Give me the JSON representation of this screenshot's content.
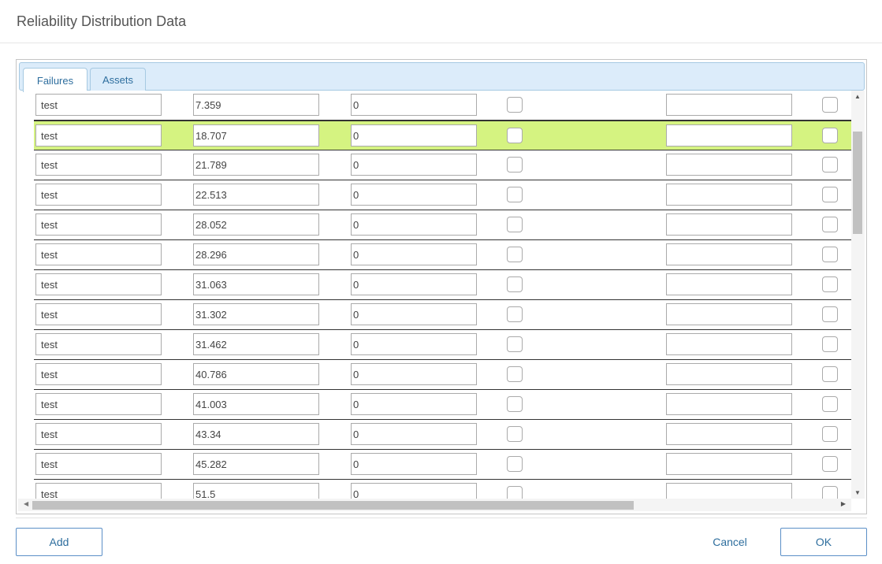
{
  "dialog": {
    "title": "Reliability Distribution Data"
  },
  "tabs": [
    {
      "label": "Failures",
      "active": true
    },
    {
      "label": "Assets",
      "active": false
    }
  ],
  "rows": [
    {
      "name": "test",
      "time": "7.359",
      "qty": "0",
      "note": "",
      "selected": false
    },
    {
      "name": "test",
      "time": "18.707",
      "qty": "0",
      "note": "",
      "selected": true
    },
    {
      "name": "test",
      "time": "21.789",
      "qty": "0",
      "note": "",
      "selected": false
    },
    {
      "name": "test",
      "time": "22.513",
      "qty": "0",
      "note": "",
      "selected": false
    },
    {
      "name": "test",
      "time": "28.052",
      "qty": "0",
      "note": "",
      "selected": false
    },
    {
      "name": "test",
      "time": "28.296",
      "qty": "0",
      "note": "",
      "selected": false
    },
    {
      "name": "test",
      "time": "31.063",
      "qty": "0",
      "note": "",
      "selected": false
    },
    {
      "name": "test",
      "time": "31.302",
      "qty": "0",
      "note": "",
      "selected": false
    },
    {
      "name": "test",
      "time": "31.462",
      "qty": "0",
      "note": "",
      "selected": false
    },
    {
      "name": "test",
      "time": "40.786",
      "qty": "0",
      "note": "",
      "selected": false
    },
    {
      "name": "test",
      "time": "41.003",
      "qty": "0",
      "note": "",
      "selected": false
    },
    {
      "name": "test",
      "time": "43.34",
      "qty": "0",
      "note": "",
      "selected": false
    },
    {
      "name": "test",
      "time": "45.282",
      "qty": "0",
      "note": "",
      "selected": false
    },
    {
      "name": "test",
      "time": "51.5",
      "qty": "0",
      "note": "",
      "selected": false
    }
  ],
  "footer": {
    "add_label": "Add",
    "cancel_label": "Cancel",
    "ok_label": "OK"
  },
  "colors": {
    "selected_row": "#d5f381",
    "accent": "#2e6e9e",
    "tab_bg": "#dcecfa"
  },
  "icons": {
    "scroll_up": "arrow-up-icon",
    "scroll_down": "arrow-down-icon",
    "scroll_left": "arrow-left-icon",
    "scroll_right": "arrow-right-icon"
  }
}
